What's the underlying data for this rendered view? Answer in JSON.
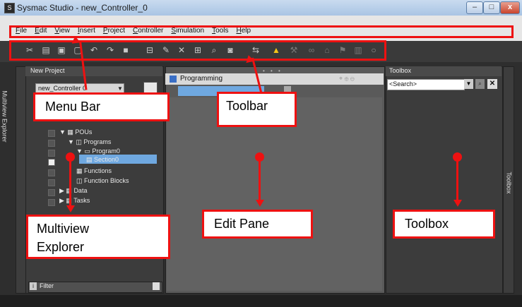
{
  "window": {
    "title": "Sysmac Studio - new_Controller_0",
    "app_icon": "app-icon",
    "buttons": [
      "–",
      "□",
      "x"
    ]
  },
  "menubar": {
    "items": [
      "File",
      "Edit",
      "View",
      "Insert",
      "Project",
      "Controller",
      "Simulation",
      "Tools",
      "Help"
    ]
  },
  "toolbar": {
    "icons": [
      "cut-icon",
      "copy-icon",
      "paste-icon",
      "delete-icon",
      "undo-icon",
      "redo-icon",
      "save-icon",
      "build-icon",
      "pen-icon",
      "cross-reference-icon",
      "watch-icon",
      "search-icon",
      "stop-icon",
      "transfer-icon",
      "warning-icon",
      "tool-icon",
      "link-icon",
      "monitor-icon",
      "flag-icon",
      "plc-icon",
      "reload-icon"
    ]
  },
  "multiview": {
    "title": "New Project",
    "side_tab": "Multiview Explorer",
    "dropdown": "new_Controller 0",
    "tree": [
      {
        "label": "POUs"
      },
      {
        "label": "Programs"
      },
      {
        "label": "Program0"
      },
      {
        "label": "Section0"
      },
      {
        "label": "Functions"
      },
      {
        "label": "Function Blocks"
      },
      {
        "label": "Data"
      },
      {
        "label": "Tasks"
      }
    ],
    "filter": "Filter"
  },
  "edit_pane": {
    "title": "Programming",
    "dots": "• • •",
    "tools": "⌖ ⊕ ⊖"
  },
  "toolbox": {
    "title": "Toolbox",
    "side_tab": "Toolbox",
    "search_placeholder": "<Search>"
  },
  "callouts": {
    "menu_bar": "Menu Bar",
    "toolbar": "Toolbar",
    "multiview_line1": "Multiview",
    "multiview_line2": "Explorer",
    "edit_pane": "Edit Pane",
    "toolbox": "Toolbox"
  },
  "colors": {
    "callout_red": "#e11111",
    "panel_dark": "#3c3c3c",
    "selection_blue": "#6fa8e0"
  }
}
